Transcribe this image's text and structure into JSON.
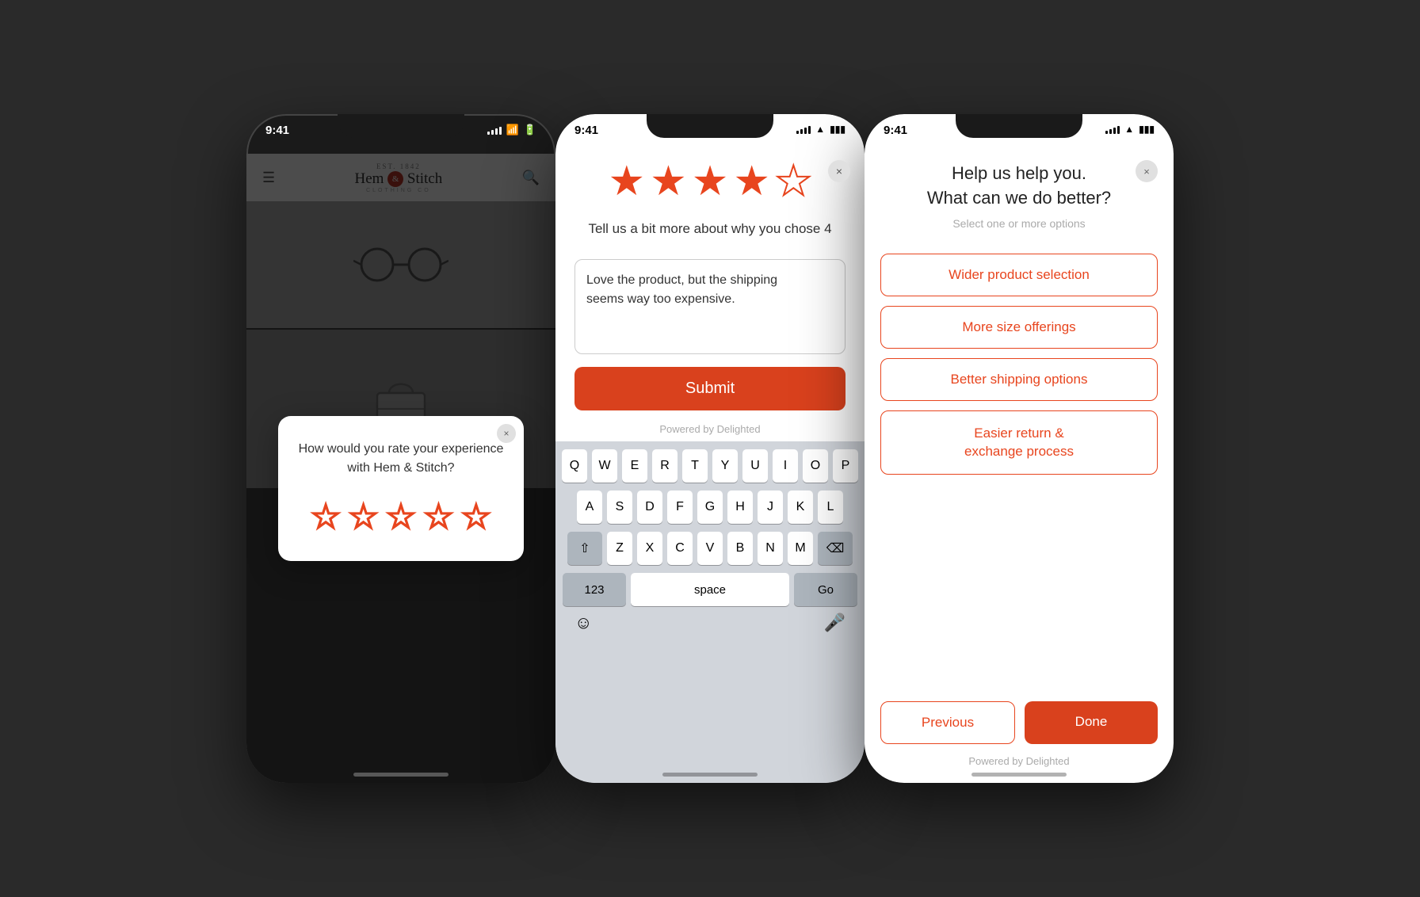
{
  "phones": {
    "phone1": {
      "time": "9:41",
      "app": {
        "name": "Hem",
        "symbol": "&",
        "name2": "Stitch",
        "sub": "CLOTHING CO",
        "est": "EST. 1842"
      },
      "modal": {
        "title": "How would you rate your experience\nwith Hem & Stitch?",
        "close_label": "×",
        "stars": [
          {
            "type": "outline"
          },
          {
            "type": "outline"
          },
          {
            "type": "outline"
          },
          {
            "type": "outline"
          },
          {
            "type": "outline"
          }
        ]
      }
    },
    "phone2": {
      "time": "9:41",
      "stars": [
        {
          "type": "filled"
        },
        {
          "type": "filled"
        },
        {
          "type": "filled"
        },
        {
          "type": "filled"
        },
        {
          "type": "outline"
        }
      ],
      "label": "Tell us a bit more about why you chose 4",
      "textarea_value": "Love the product, but the shipping\nseems way too expensive.",
      "submit_label": "Submit",
      "powered_label": "Powered by Delighted",
      "keyboard": {
        "row1": [
          "Q",
          "W",
          "E",
          "R",
          "T",
          "Y",
          "U",
          "I",
          "O",
          "P"
        ],
        "row2": [
          "A",
          "S",
          "D",
          "F",
          "G",
          "H",
          "J",
          "K",
          "L"
        ],
        "row3_mid": [
          "Z",
          "X",
          "C",
          "V",
          "B",
          "N",
          "M"
        ],
        "num_label": "123",
        "space_label": "space",
        "go_label": "Go"
      }
    },
    "phone3": {
      "time": "9:41",
      "close_label": "×",
      "title_line1": "Help us help you.",
      "title_line2": "What can we do better?",
      "subtitle": "Select one or more options",
      "options": [
        "Wider product selection",
        "More size offerings",
        "Better shipping options",
        "Easier return &\nexchange process"
      ],
      "prev_label": "Previous",
      "done_label": "Done",
      "powered_label": "Powered by Delighted"
    }
  }
}
